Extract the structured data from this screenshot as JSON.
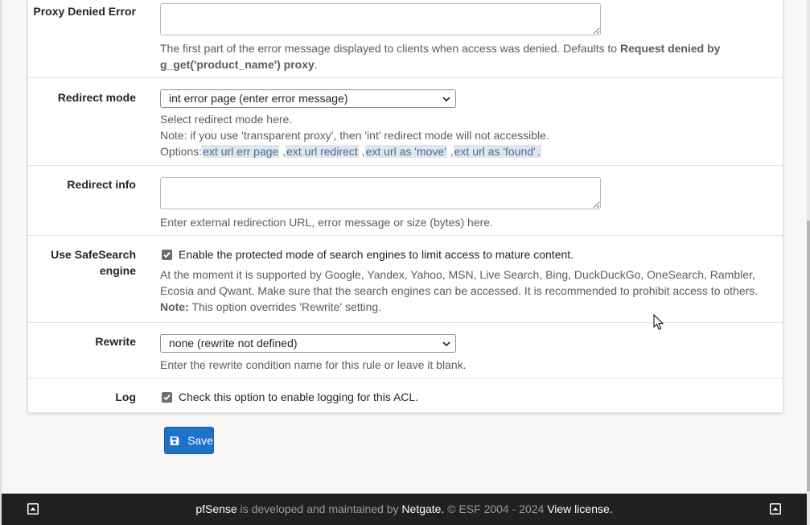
{
  "proxy_denied": {
    "label": "Proxy Denied Error",
    "value": "",
    "help_prefix": "The first part of the error message displayed to clients when access was denied. Defaults to ",
    "help_bold": "Request denied by g_get('product_name') proxy",
    "help_suffix": "."
  },
  "redirect_mode": {
    "label": "Redirect mode",
    "selected": "int error page (enter error message)",
    "help1": "Select redirect mode here.",
    "help2": "Note: if you use 'transparent proxy', then 'int' redirect mode will not accessible.",
    "options_prefix": "Options:",
    "options": [
      "ext url err page",
      "ext url redirect",
      "ext url as 'move'",
      "ext url as 'found'"
    ],
    "sep": ",",
    "end": "."
  },
  "redirect_info": {
    "label": "Redirect info",
    "value": "",
    "help": "Enter external redirection URL, error message or size (bytes) here."
  },
  "safesearch": {
    "label_line1": "Use SafeSearch",
    "label_line2": "engine",
    "checked": true,
    "check_label": "Enable the protected mode of search engines to limit access to mature content.",
    "help": "At the moment it is supported by Google, Yandex, Yahoo, MSN, Live Search, Bing, DuckDuckGo, OneSearch, Rambler, Ecosia and Qwant. Make sure that the search engines can be accessed. It is recommended to prohibit access to others.",
    "note_bold": "Note:",
    "note_text": " This option overrides 'Rewrite' setting."
  },
  "rewrite": {
    "label": "Rewrite",
    "selected": "none (rewrite not defined)",
    "help": "Enter the rewrite condition name for this rule or leave it blank."
  },
  "log": {
    "label": "Log",
    "checked": true,
    "check_label": "Check this option to enable logging for this ACL."
  },
  "save": {
    "label": "Save",
    "icon": "floppy-disk-icon",
    "color": "#1e73c9"
  },
  "footer": {
    "brand": "pfSense",
    "mid": " is developed and maintained by ",
    "company": "Netgate.",
    "copy": " © ESF 2004 - 2024 ",
    "license": "View license.",
    "icon": "scroll-up-icon",
    "background": "#212121"
  }
}
